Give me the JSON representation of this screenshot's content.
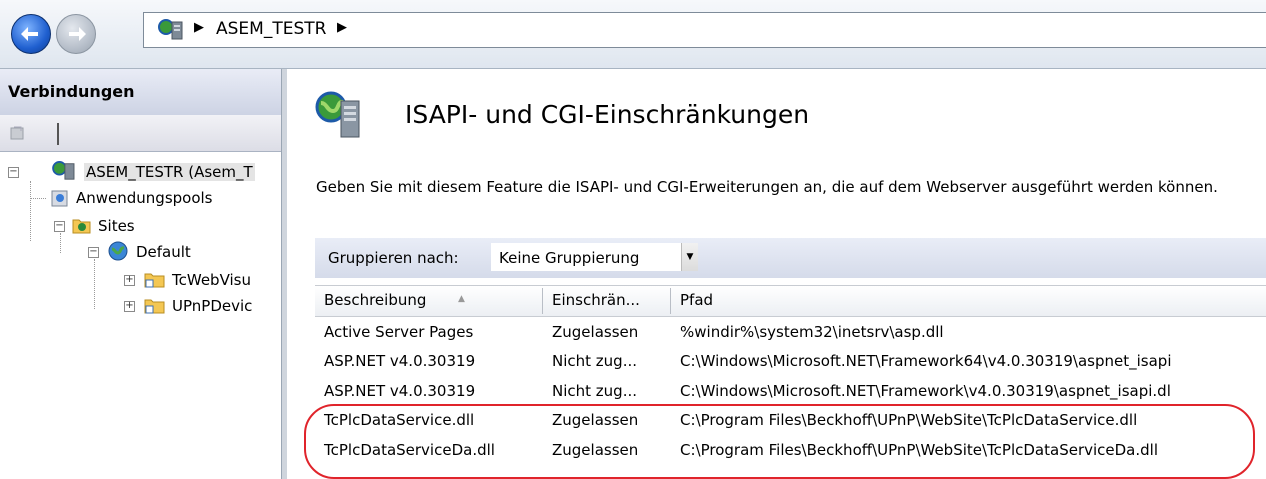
{
  "navbar": {
    "address_path": "ASEM_TESTR",
    "separator": "▶"
  },
  "left_pane": {
    "title": "Verbindungen",
    "tree": {
      "server": "ASEM_TESTR (Asem_T",
      "app_pools": "Anwendungspools",
      "sites": "Sites",
      "default": "Default",
      "child1": "TcWebVisu",
      "child2": "UPnPDevic"
    }
  },
  "content": {
    "title": "ISAPI- und CGI-Einschränkungen",
    "description": "Geben Sie mit diesem Feature die ISAPI- und CGI-Erweiterungen an, die auf dem Webserver ausgeführt werden können.",
    "group_label": "Gruppieren nach:",
    "group_value": "Keine Gruppierung",
    "columns": [
      "Beschreibung",
      "Einschrän...",
      "Pfad"
    ],
    "rows": [
      [
        "Active Server Pages",
        "Zugelassen",
        "%windir%\\system32\\inetsrv\\asp.dll"
      ],
      [
        "ASP.NET v4.0.30319",
        "Nicht zug...",
        "C:\\Windows\\Microsoft.NET\\Framework64\\v4.0.30319\\aspnet_isapi"
      ],
      [
        "ASP.NET v4.0.30319",
        "Nicht zug...",
        "C:\\Windows\\Microsoft.NET\\Framework\\v4.0.30319\\aspnet_isapi.dl"
      ],
      [
        "TcPlcDataService.dll",
        "Zugelassen",
        "C:\\Program Files\\Beckhoff\\UPnP\\WebSite\\TcPlcDataService.dll"
      ],
      [
        "TcPlcDataServiceDa.dll",
        "Zugelassen",
        "C:\\Program Files\\Beckhoff\\UPnP\\WebSite\\TcPlcDataServiceDa.dll"
      ]
    ]
  },
  "colors": {
    "highlight": "#e0242b",
    "nav_back": "#1f5fcf"
  }
}
